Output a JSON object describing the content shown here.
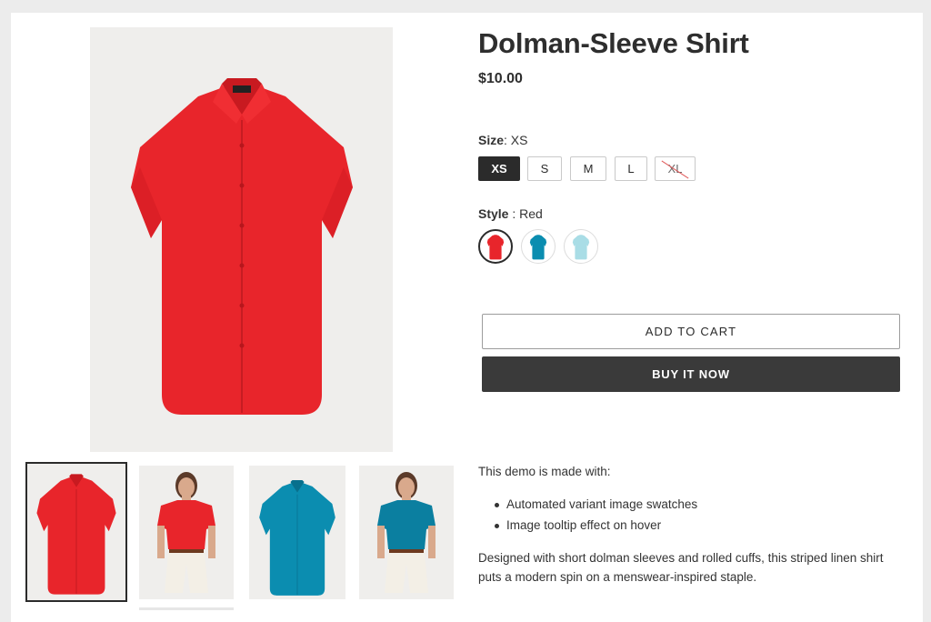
{
  "product": {
    "title": "Dolman-Sleeve Shirt",
    "price": "$10.00"
  },
  "size": {
    "label": "Size",
    "selected": "XS",
    "options": [
      "XS",
      "S",
      "M",
      "L",
      "XL"
    ],
    "unavailable": [
      "XL"
    ]
  },
  "style": {
    "label": "Style",
    "selected": "Red",
    "options": [
      "Red",
      "Teal",
      "Light Blue"
    ]
  },
  "actions": {
    "add_to_cart": "ADD TO CART",
    "buy_now": "BUY IT NOW"
  },
  "description": {
    "intro": "This demo is made with:",
    "bullets": [
      "Automated variant image swatches",
      "Image tooltip effect on hover"
    ],
    "body": "Designed with short dolman sleeves and rolled cuffs, this striped linen shirt puts a modern spin on a menswear-inspired staple."
  },
  "colors": {
    "red": "#e8252b",
    "teal": "#0b8db0",
    "light_blue": "#a9dde6",
    "dark": "#2b2b2b"
  },
  "gallery": {
    "images": [
      "shirt-red-flat",
      "model-red",
      "shirt-teal-flat",
      "model-teal"
    ],
    "selected_index": 0
  }
}
